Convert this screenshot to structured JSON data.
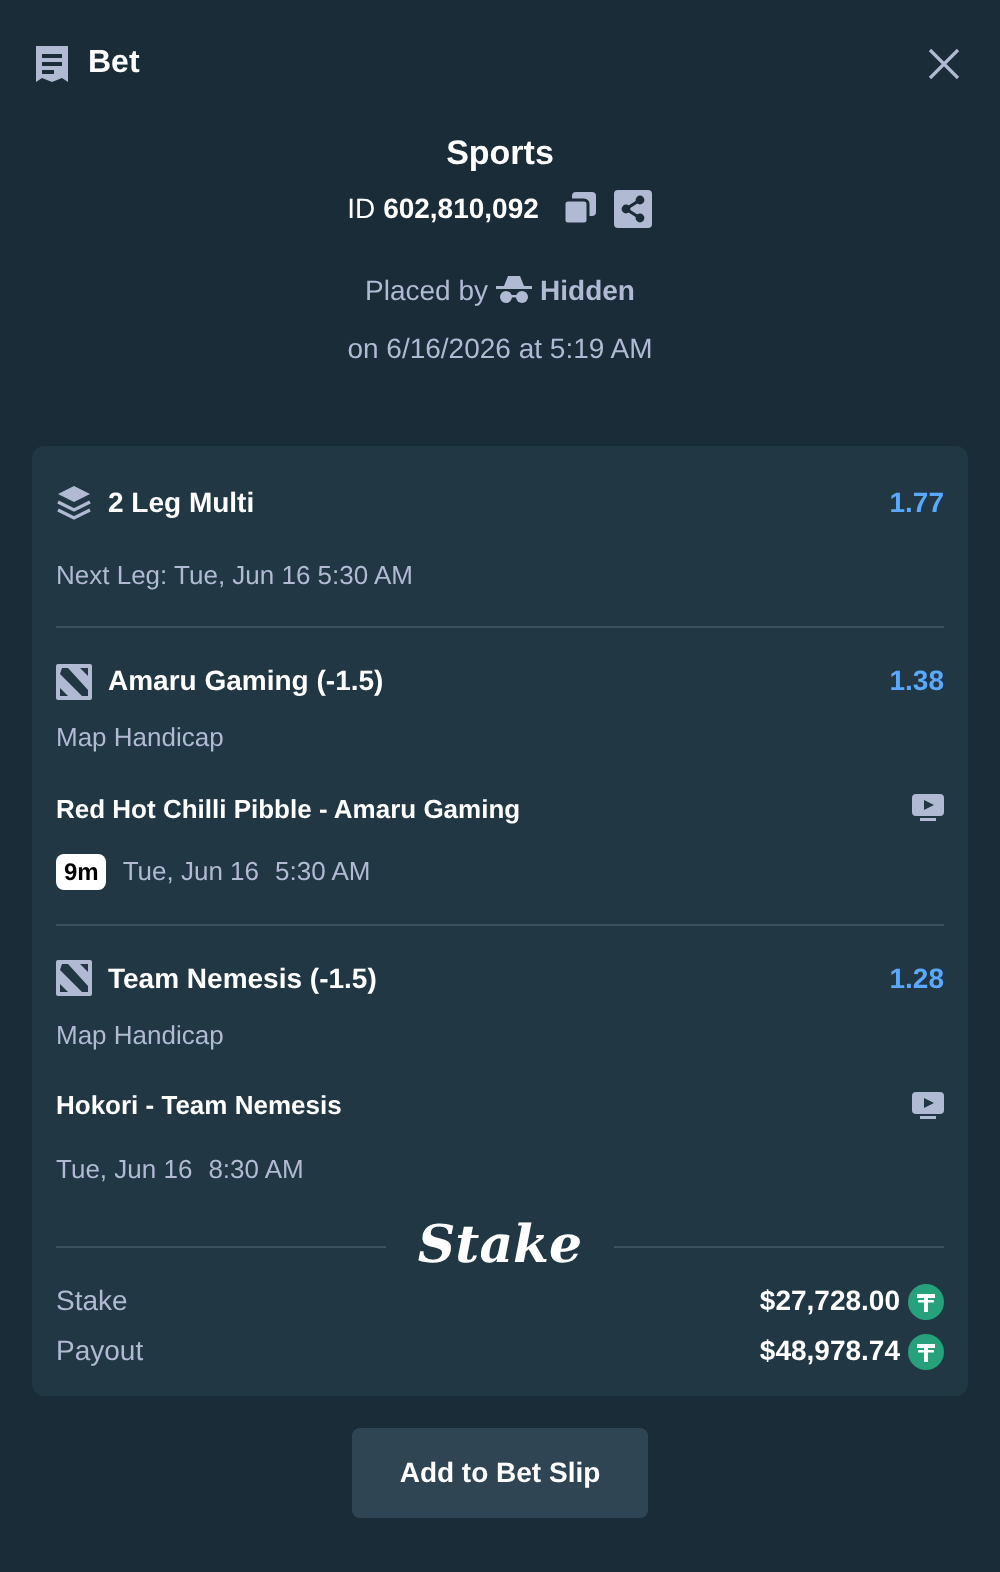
{
  "header": {
    "title": "Bet"
  },
  "summary": {
    "title": "Sports",
    "id_label": "ID",
    "id_value": "602,810,092",
    "placed_by": "Placed by",
    "user": "Hidden",
    "placed_on": "on 6/16/2026 at 5:19 AM"
  },
  "multi": {
    "title": "2 Leg Multi",
    "odds": "1.77",
    "next_leg": "Next Leg: Tue, Jun 16 5:30 AM"
  },
  "legs": [
    {
      "selection": "Amaru Gaming (-1.5)",
      "odds": "1.38",
      "market": "Map Handicap",
      "match": "Red Hot Chilli Pibble - Amaru Gaming",
      "badge": "9m",
      "date": "Tue, Jun 16",
      "time": "5:30 AM"
    },
    {
      "selection": "Team Nemesis (-1.5)",
      "odds": "1.28",
      "market": "Map Handicap",
      "match": "Hokori - Team Nemesis",
      "date": "Tue, Jun 16",
      "time": "8:30 AM"
    }
  ],
  "logo": "Stake",
  "totals": [
    {
      "label": "Stake",
      "amount": "$27,728.00"
    },
    {
      "label": "Payout",
      "amount": "$48,978.74"
    }
  ],
  "button": "Add to Bet Slip"
}
